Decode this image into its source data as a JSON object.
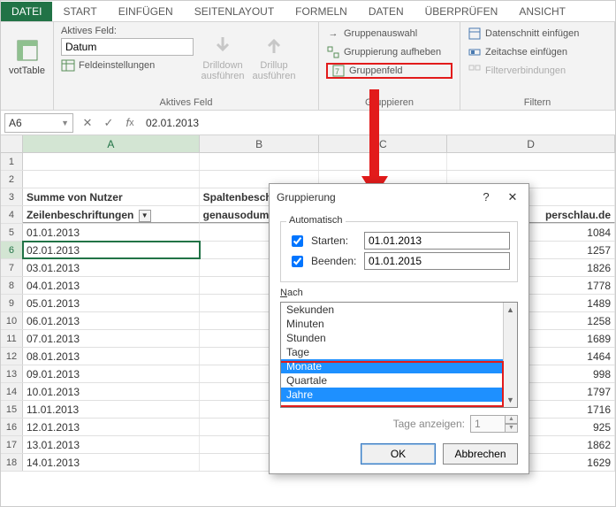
{
  "tabs": [
    "DATEI",
    "START",
    "EINFÜGEN",
    "SEITENLAYOUT",
    "FORMELN",
    "DATEN",
    "ÜBERPRÜFEN",
    "ANSICHT"
  ],
  "ribbon": {
    "pivot_label": "votTable",
    "active_field_label": "Aktives Feld:",
    "active_field_value": "Datum",
    "field_settings": "Feldeinstellungen",
    "active_field_group": "Aktives Feld",
    "drilldown": "Drilldown ausführen",
    "drillup": "Drillup ausführen",
    "group_select": "Gruppenauswahl",
    "group_remove": "Gruppierung aufheben",
    "group_field": "Gruppenfeld",
    "group_group": "Gruppieren",
    "slicer": "Datenschnitt einfügen",
    "timeline": "Zeitachse einfügen",
    "filter_conn": "Filterverbindungen",
    "filter_group": "Filtern"
  },
  "formula_bar": {
    "name_box": "A6",
    "value": "02.01.2013"
  },
  "columns": [
    "A",
    "B",
    "C",
    "D"
  ],
  "header_rows": {
    "r3": {
      "A": "Summe von Nutzer",
      "B": "Spaltenbesch"
    },
    "r4": {
      "A": "Zeilenbeschriftungen",
      "B": "genausodumm",
      "D": "perschlau.de"
    }
  },
  "rows": [
    {
      "n": 5,
      "date": "01.01.2013",
      "d": 1084
    },
    {
      "n": 6,
      "date": "02.01.2013",
      "d": 1257
    },
    {
      "n": 7,
      "date": "03.01.2013",
      "d": 1826
    },
    {
      "n": 8,
      "date": "04.01.2013",
      "d": 1778
    },
    {
      "n": 9,
      "date": "05.01.2013",
      "d": 1489
    },
    {
      "n": 10,
      "date": "06.01.2013",
      "d": 1258
    },
    {
      "n": 11,
      "date": "07.01.2013",
      "d": 1689
    },
    {
      "n": 12,
      "date": "08.01.2013",
      "d": 1464
    },
    {
      "n": 13,
      "date": "09.01.2013",
      "d": 998
    },
    {
      "n": 14,
      "date": "10.01.2013",
      "d": 1797
    },
    {
      "n": 15,
      "date": "11.01.2013",
      "d": 1716
    },
    {
      "n": 16,
      "date": "12.01.2013",
      "d": 925
    },
    {
      "n": 17,
      "date": "13.01.2013",
      "d": 1862
    },
    {
      "n": 18,
      "date": "14.01.2013",
      "d": 1629
    }
  ],
  "dialog": {
    "title": "Gruppierung",
    "auto_label": "Automatisch",
    "start_label": "Starten:",
    "start_value": "01.01.2013",
    "end_label": "Beenden:",
    "end_value": "01.01.2015",
    "by_label": "Nach",
    "options": [
      "Sekunden",
      "Minuten",
      "Stunden",
      "Tage",
      "Monate",
      "Quartale",
      "Jahre"
    ],
    "selected": [
      "Monate",
      "Jahre"
    ],
    "days_label": "Tage anzeigen:",
    "days_value": "1",
    "ok": "OK",
    "cancel": "Abbrechen"
  }
}
